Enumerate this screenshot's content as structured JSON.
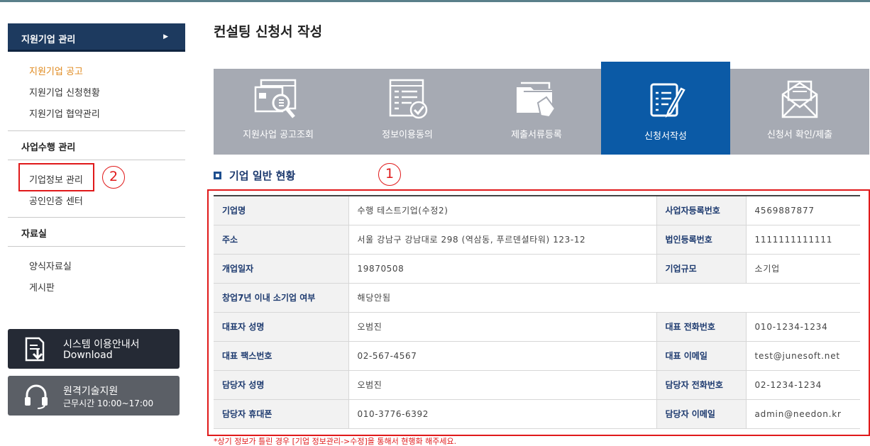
{
  "sidebar": {
    "header": "지원기업 관리",
    "group1": [
      "지원기업 공고",
      "지원기업 신청현황",
      "지원기업 협약관리"
    ],
    "section2": "사업수행 관리",
    "group2": [
      "기업정보 관리",
      "공인인증 센터"
    ],
    "section3": "자료실",
    "group3": [
      "양식자료실",
      "게시판"
    ],
    "callout": "2",
    "manual_btn": {
      "line1": "시스템 이용안내서",
      "line2": "Download",
      "icon": "download-document-icon"
    },
    "support_btn": {
      "line1": "원격기술지원",
      "line2": "근무시간 10:00~17:00",
      "icon": "headset-icon"
    }
  },
  "main": {
    "title": "컨설팅 신청서 작성",
    "steps": [
      {
        "label": "지원사업 공고조회",
        "icon": "search-document-icon"
      },
      {
        "label": "정보이용동의",
        "icon": "checklist-icon"
      },
      {
        "label": "제출서류등록",
        "icon": "file-folders-icon"
      },
      {
        "label": "신청서작성",
        "icon": "write-form-icon"
      },
      {
        "label": "신청서 확인/제출",
        "icon": "mail-icon"
      }
    ],
    "active_step": 3,
    "section_title": "기업 일반 현황",
    "callout": "1",
    "rows": [
      {
        "l1": "기업명",
        "v1": "수행 테스트기업(수정2)",
        "l2": "사업자등록번호",
        "v2": "4569887877"
      },
      {
        "l1": "주소",
        "v1": "서울 강남구 강남대로 298 (역삼동, 푸르덴셜타워) 123-12",
        "l2": "법인등록번호",
        "v2": "1111111111111"
      },
      {
        "l1": "개업일자",
        "v1": "19870508",
        "l2": "기업규모",
        "v2": "소기업"
      },
      {
        "l1": "창업7년 이내 소기업 여부",
        "v1": "해당안됨"
      },
      {
        "l1": "대표자 성명",
        "v1": "오범진",
        "l2": "대표 전화번호",
        "v2": "010-1234-1234"
      },
      {
        "l1": "대표 팩스번호",
        "v1": "02-567-4567",
        "l2": "대표 이메일",
        "v2": "test@junesoft.net"
      },
      {
        "l1": "담당자 성명",
        "v1": "오범진",
        "l2": "담당자 전화번호",
        "v2": "02-1234-1234"
      },
      {
        "l1": "담당자 휴대폰",
        "v1": "010-3776-6392",
        "l2": "담당자 이메일",
        "v2": "admin@needon.kr"
      }
    ],
    "note": "*상기 정보가 틀린 경우 [기업 정보관리->수정]을 통해서 현행화 해주세요."
  },
  "colors": {
    "accent_navy": "#1d3a5f",
    "active_step": "#0b5aa6",
    "steps_bg": "#a6aab3",
    "highlight_red": "#e0191a",
    "active_link": "#e08a1e"
  }
}
